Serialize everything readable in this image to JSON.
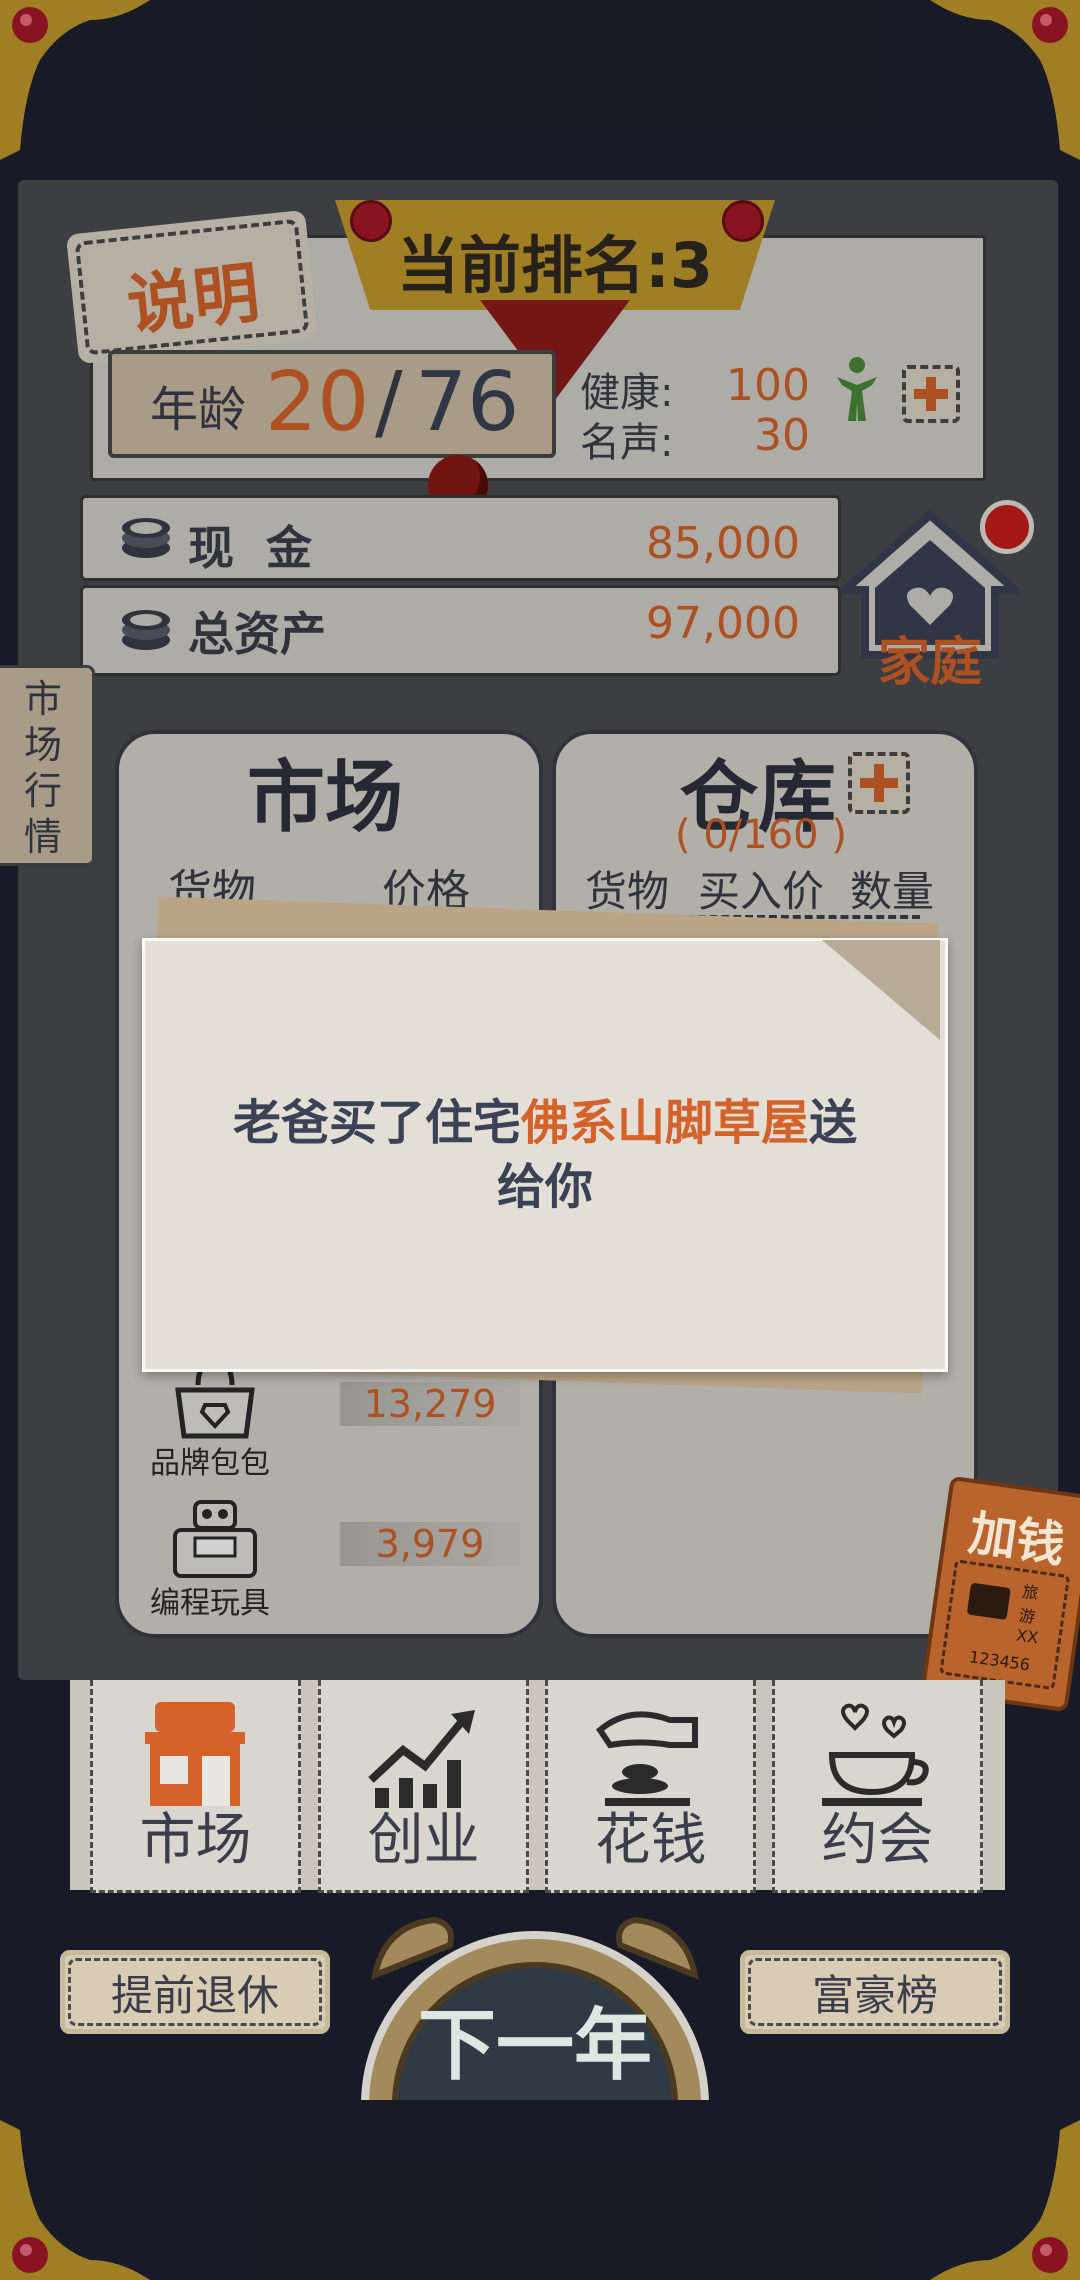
{
  "header": {
    "help_label": "说明",
    "rank_label": "当前排名:3",
    "age_label": "年龄",
    "age_current": "20",
    "age_separator": "/",
    "age_max": "76",
    "health_label": "健康:",
    "health_value": "100",
    "fame_label": "名声:",
    "fame_value": "30"
  },
  "finance": {
    "cash_label": "现  金",
    "cash_value": "85,000",
    "assets_label": "总资产",
    "assets_value": "97,000"
  },
  "family_label": "家庭",
  "market_trend_tab": "市场行情",
  "market": {
    "title": "市场",
    "col_goods": "货物",
    "col_price": "价格",
    "items": [
      {
        "name": "品牌包包",
        "price": "13,279",
        "icon": "handbag-icon"
      },
      {
        "name": "编程玩具",
        "price": "3,979",
        "icon": "robot-toy-icon"
      }
    ]
  },
  "warehouse": {
    "title": "仓库",
    "capacity": "( 0/160 )",
    "col_goods": "货物",
    "col_buy_price": "买入价",
    "col_quantity": "数量"
  },
  "dialog": {
    "text_before": "老爸买了住宅",
    "highlight": "佛系山脚草屋",
    "text_after": "送",
    "text_line2": "给你"
  },
  "add_money_label": "加钱",
  "ticket_code": "123456",
  "ticket_small": "旅游XX",
  "tabs": [
    {
      "label": "市场",
      "icon": "shop-icon"
    },
    {
      "label": "创业",
      "icon": "growth-chart-icon"
    },
    {
      "label": "花钱",
      "icon": "spend-hand-icon"
    },
    {
      "label": "约会",
      "icon": "coffee-date-icon"
    }
  ],
  "bottom": {
    "retire_label": "提前退休",
    "next_year_label": "下一年",
    "rich_list_label": "富豪榜"
  },
  "colors": {
    "accent_orange": "#d4622a",
    "text_dark": "#3b3e4a",
    "background": "#1e2230",
    "gold": "#c49a2c"
  }
}
